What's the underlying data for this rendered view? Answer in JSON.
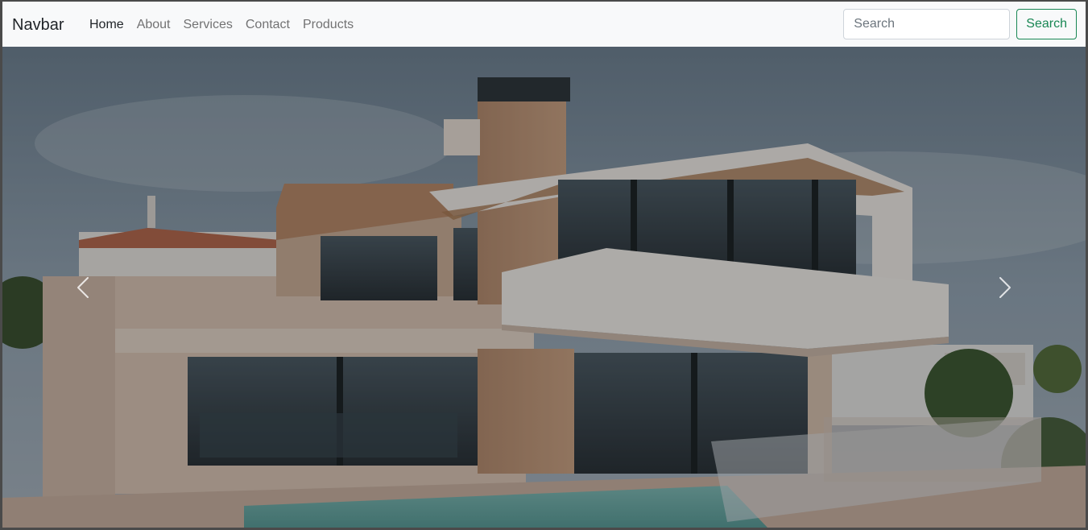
{
  "navbar": {
    "brand": "Navbar",
    "links": [
      {
        "label": "Home",
        "active": true
      },
      {
        "label": "About",
        "active": false
      },
      {
        "label": "Services",
        "active": false
      },
      {
        "label": "Contact",
        "active": false
      },
      {
        "label": "Products",
        "active": false
      }
    ],
    "search": {
      "placeholder": "Search",
      "button_label": "Search"
    }
  },
  "carousel": {
    "slide_description_icon": "modern-house-photo",
    "controls": {
      "prev_icon": "chevron-left-icon",
      "next_icon": "chevron-right-icon"
    }
  },
  "colors": {
    "navbar_bg": "#f8f9fa",
    "accent_success": "#198754",
    "link_muted": "rgba(0,0,0,0.55)"
  }
}
